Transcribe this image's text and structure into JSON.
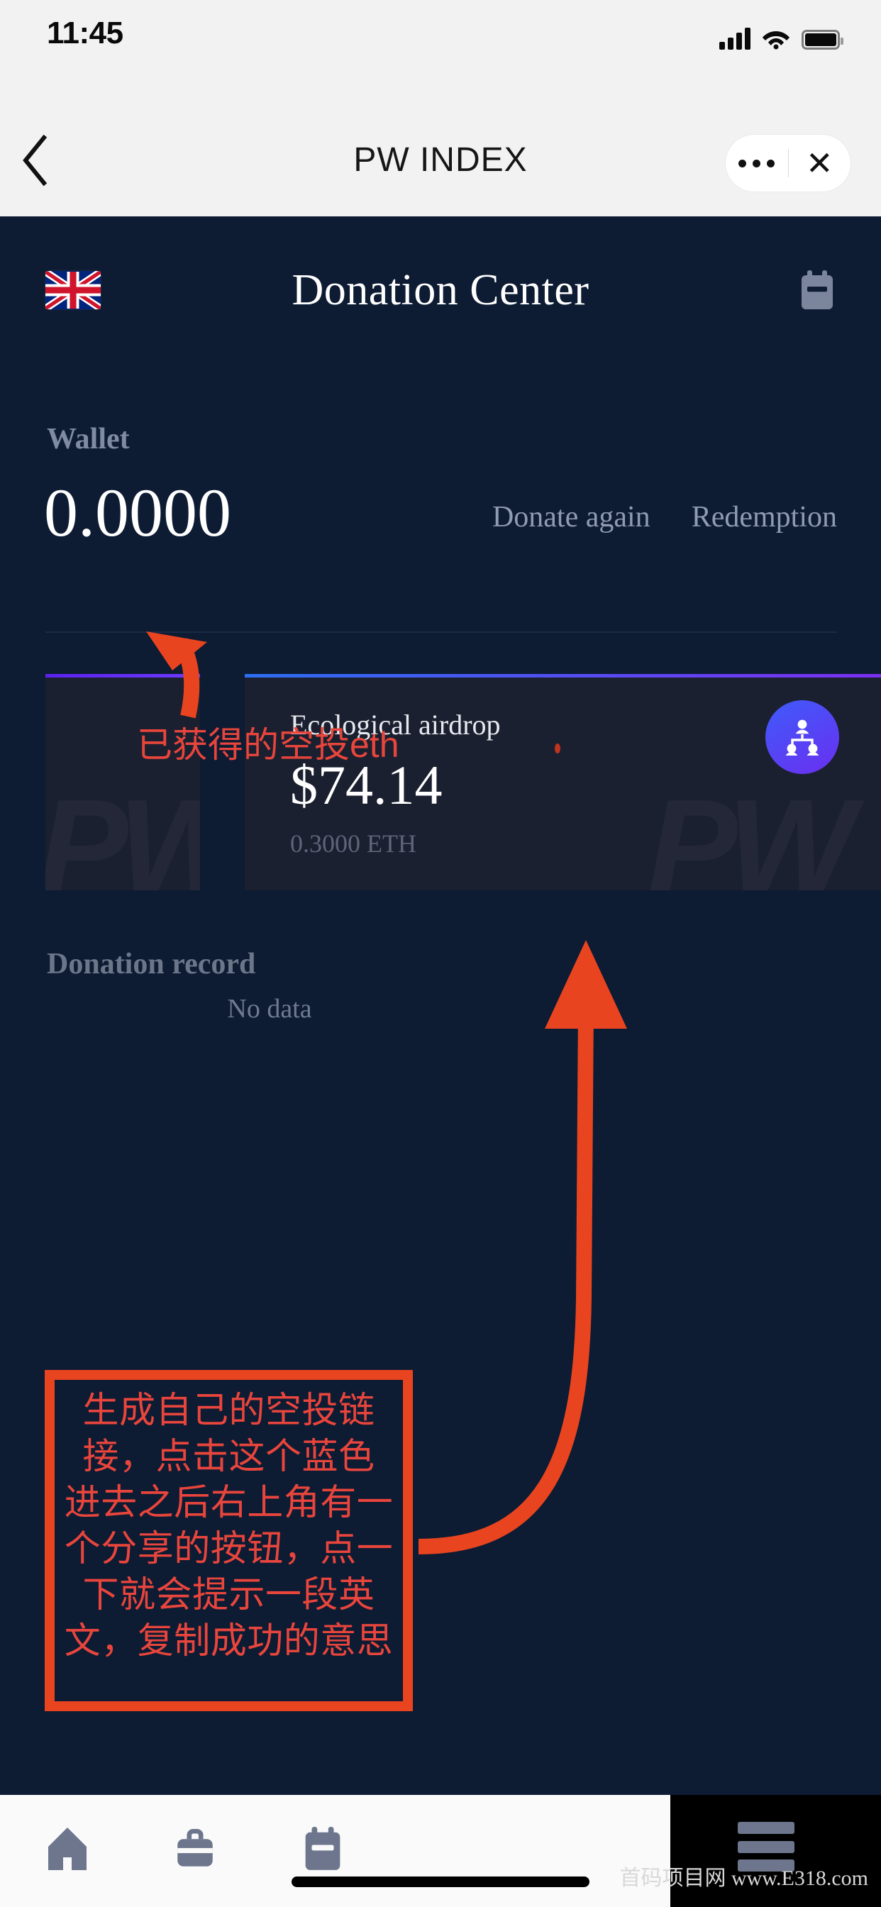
{
  "status_bar": {
    "time": "11:45",
    "signal_icon": "cellular-signal-icon",
    "wifi_icon": "wifi-icon",
    "battery_icon": "battery-full-icon"
  },
  "nav_bar": {
    "title": "PW INDEX",
    "back_icon": "chevron-left-icon",
    "menu_icon": "more-options-icon",
    "close_label": "✕"
  },
  "app_header": {
    "title": "Donation Center",
    "language_flag": "uk-flag-icon",
    "right_icon": "wallet-icon"
  },
  "wallet": {
    "label": "Wallet",
    "amount": "0.0000",
    "actions": [
      "Donate again",
      "Redemption"
    ]
  },
  "cards": [
    {
      "accent": "#5b22ee",
      "watermark": "PW"
    },
    {
      "accent": "#2c6ef2",
      "title": "Ecological airdrop",
      "value": "$74.14",
      "sub": "0.3000 ETH",
      "watermark": "PW",
      "share_icon": "share-network-icon"
    }
  ],
  "record": {
    "label": "Donation record",
    "empty_text": "No data"
  },
  "tab_bar": {
    "items": [
      {
        "icon": "home-icon"
      },
      {
        "icon": "briefcase-icon"
      },
      {
        "icon": "wallet-icon"
      }
    ],
    "menu_icon": "hamburger-menu-icon",
    "watermark": "首码项目网  www.E318.com"
  },
  "annotations": {
    "arrow_color": "#e8441f",
    "text_color": "#e8453c",
    "label_eth": "已获得的空投eth",
    "box_text": "生成自己的空投链接，点击这个蓝色 进去之后右上角有一个分享的按钮，点一下就会提示一段英文，复制成功的意思"
  }
}
